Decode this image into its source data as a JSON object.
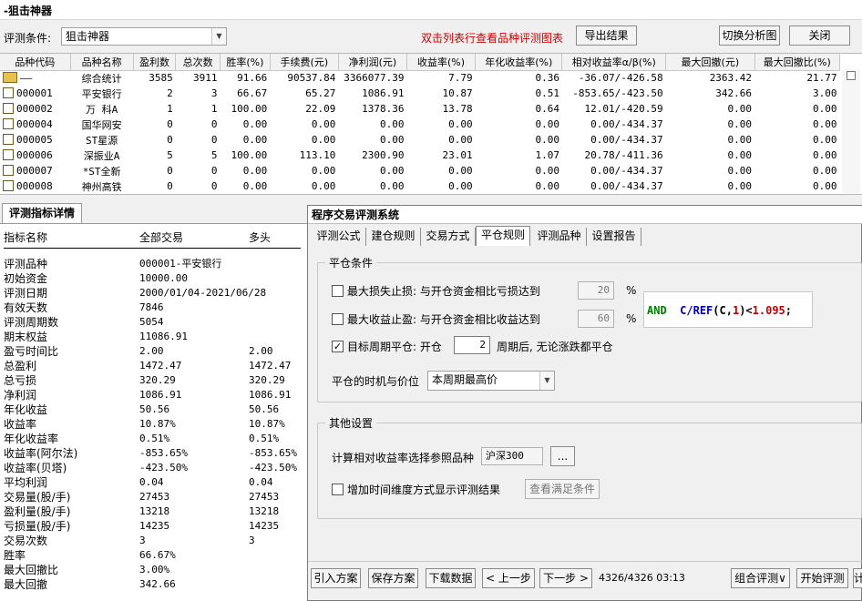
{
  "window": {
    "title": "-狙击神器"
  },
  "toolbar": {
    "criteria_label": "评测条件:",
    "criteria_value": "狙击神器",
    "hint": "双击列表行查看品种评测图表",
    "export_label": "导出结果",
    "switch_label": "切换分析图",
    "close_label": "关闭"
  },
  "colors": {
    "hint_red": "#cc0000",
    "formula_keyword": "#008000",
    "formula_function": "#0000c0",
    "formula_number": "#c00000"
  },
  "grid": {
    "columns": [
      "品种代码",
      "品种名称",
      "盈利数",
      "总次数",
      "胜率(%)",
      "手续费(元)",
      "净利润(元)",
      "收益率(%)",
      "年化收益率(%)",
      "相对收益率α/β(%)",
      "最大回撤(元)",
      "最大回撤比(%)"
    ],
    "rows": [
      {
        "code": "——",
        "name": "综合统计",
        "win": "3585",
        "total": "3911",
        "rate": "91.66",
        "fee": "90537.84",
        "net": "3366077.39",
        "ret": "7.79",
        "annual": "0.36",
        "rel": "-36.07/-426.58",
        "maxdd": "2363.42",
        "ddratio": "21.77",
        "icon": "summary-icon"
      },
      {
        "code": "000001",
        "name": "平安银行",
        "win": "2",
        "total": "3",
        "rate": "66.67",
        "fee": "65.27",
        "net": "1086.91",
        "ret": "10.87",
        "annual": "0.51",
        "rel": "-853.65/-423.50",
        "maxdd": "342.66",
        "ddratio": "3.00",
        "icon": "file-icon"
      },
      {
        "code": "000002",
        "name": "万 科A",
        "win": "1",
        "total": "1",
        "rate": "100.00",
        "fee": "22.09",
        "net": "1378.36",
        "ret": "13.78",
        "annual": "0.64",
        "rel": "12.01/-420.59",
        "maxdd": "0.00",
        "ddratio": "0.00",
        "icon": "file-icon"
      },
      {
        "code": "000004",
        "name": "国华网安",
        "win": "0",
        "total": "0",
        "rate": "0.00",
        "fee": "0.00",
        "net": "0.00",
        "ret": "0.00",
        "annual": "0.00",
        "rel": "0.00/-434.37",
        "maxdd": "0.00",
        "ddratio": "0.00",
        "icon": "file-icon"
      },
      {
        "code": "000005",
        "name": "ST星源",
        "win": "0",
        "total": "0",
        "rate": "0.00",
        "fee": "0.00",
        "net": "0.00",
        "ret": "0.00",
        "annual": "0.00",
        "rel": "0.00/-434.37",
        "maxdd": "0.00",
        "ddratio": "0.00",
        "icon": "file-icon"
      },
      {
        "code": "000006",
        "name": "深振业A",
        "win": "5",
        "total": "5",
        "rate": "100.00",
        "fee": "113.10",
        "net": "2300.90",
        "ret": "23.01",
        "annual": "1.07",
        "rel": "20.78/-411.36",
        "maxdd": "0.00",
        "ddratio": "0.00",
        "icon": "file-icon"
      },
      {
        "code": "000007",
        "name": "*ST全新",
        "win": "0",
        "total": "0",
        "rate": "0.00",
        "fee": "0.00",
        "net": "0.00",
        "ret": "0.00",
        "annual": "0.00",
        "rel": "0.00/-434.37",
        "maxdd": "0.00",
        "ddratio": "0.00",
        "icon": "file-icon"
      },
      {
        "code": "000008",
        "name": "神州高铁",
        "win": "0",
        "total": "0",
        "rate": "0.00",
        "fee": "0.00",
        "net": "0.00",
        "ret": "0.00",
        "annual": "0.00",
        "rel": "0.00/-434.37",
        "maxdd": "0.00",
        "ddratio": "0.00",
        "icon": "file-icon"
      }
    ]
  },
  "detail": {
    "tab_label": "评测指标详情",
    "headers": [
      "指标名称",
      "全部交易",
      "多头"
    ],
    "rows": [
      {
        "k": "评测品种",
        "a": "000001-平安银行",
        "b": ""
      },
      {
        "k": "初始资金",
        "a": "10000.00",
        "b": ""
      },
      {
        "k": "评测日期",
        "a": "2000/01/04-2021/06/28",
        "b": ""
      },
      {
        "k": "有效天数",
        "a": "7846",
        "b": ""
      },
      {
        "k": "评测周期数",
        "a": "5054",
        "b": ""
      },
      {
        "k": "期末权益",
        "a": "11086.91",
        "b": ""
      },
      {
        "k": "盈亏时间比",
        "a": "2.00",
        "b": "2.00"
      },
      {
        "k": "总盈利",
        "a": "1472.47",
        "b": "1472.47"
      },
      {
        "k": "总亏损",
        "a": "320.29",
        "b": "320.29"
      },
      {
        "k": "净利润",
        "a": "1086.91",
        "b": "1086.91"
      },
      {
        "k": "年化收益",
        "a": "50.56",
        "b": "50.56"
      },
      {
        "k": "收益率",
        "a": "10.87%",
        "b": "10.87%"
      },
      {
        "k": "年化收益率",
        "a": "0.51%",
        "b": "0.51%"
      },
      {
        "k": "收益率(阿尔法)",
        "a": "-853.65%",
        "b": "-853.65%"
      },
      {
        "k": "收益率(贝塔)",
        "a": "-423.50%",
        "b": "-423.50%"
      },
      {
        "k": "平均利润",
        "a": "0.04",
        "b": "0.04"
      },
      {
        "k": "交易量(股/手)",
        "a": "27453",
        "b": "27453"
      },
      {
        "k": "盈利量(股/手)",
        "a": "13218",
        "b": "13218"
      },
      {
        "k": "亏损量(股/手)",
        "a": "14235",
        "b": "14235"
      },
      {
        "k": "交易次数",
        "a": "3",
        "b": "3"
      },
      {
        "k": "胜率",
        "a": "66.67%",
        "b": ""
      },
      {
        "k": "最大回撤比",
        "a": "3.00%",
        "b": ""
      },
      {
        "k": "最大回撤",
        "a": "342.66",
        "b": ""
      }
    ]
  },
  "dialog": {
    "title": "程序交易评测系统",
    "tabs": [
      "评测公式",
      "建仓规则",
      "交易方式",
      "平仓规则",
      "评测品种",
      "设置报告"
    ],
    "active_tab": "平仓规则",
    "close_group": {
      "title": "平仓条件",
      "stoploss_label": "最大损失止损: 与开仓资金相比亏损达到",
      "stoploss_value": "20",
      "stoploss_checked": false,
      "takeprofit_label": "最大收益止盈: 与开仓资金相比收益达到",
      "takeprofit_value": "60",
      "takeprofit_checked": false,
      "percent": "%",
      "period_label": "目标周期平仓: 开仓",
      "period_value": "2",
      "period_suffix": "周期后, 无论涨跌都平仓",
      "period_checked": true,
      "timing_label": "平仓的时机与价位",
      "timing_value": "本周期最高价"
    },
    "formula": {
      "kw": "AND",
      "fn": "C/REF",
      "open": "(C,",
      "num1": "1",
      "close": ")<",
      "num2": "1.095",
      "end": ";"
    },
    "other_group": {
      "title": "其他设置",
      "benchmark_label": "计算相对收益率选择参照品种",
      "benchmark_value": "沪深300",
      "browse_label": "...",
      "timedim_label": "增加时间维度方式显示评测结果",
      "timedim_checked": false,
      "view_cond_label": "查看满足条件"
    },
    "bottom": {
      "import_label": "引入方案",
      "save_label": "保存方案",
      "download_label": "下载数据",
      "prev_label": "< 上一步",
      "next_label": "下一步 >",
      "progress": "4326/4326 03:13",
      "combo_label": "组合评测∨",
      "start_label": "开始评测",
      "cut_label": "计"
    }
  }
}
